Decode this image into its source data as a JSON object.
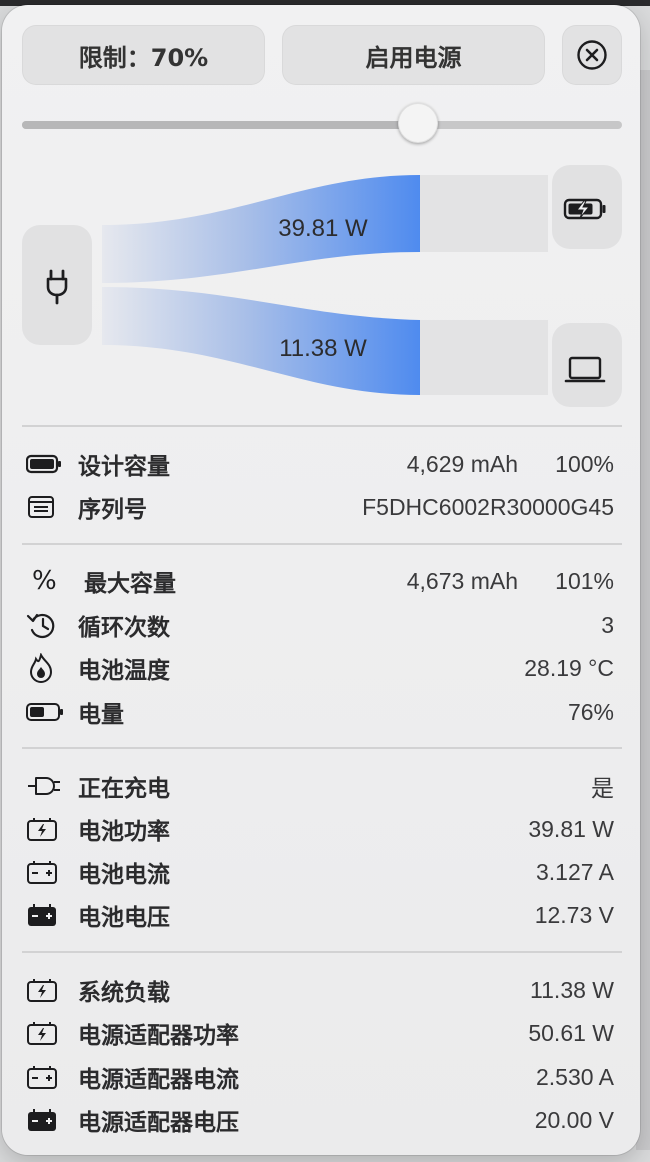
{
  "controls": {
    "limit_label": "限制：70%",
    "power_label": "启用电源",
    "charge_limit_percent": 70
  },
  "flow": {
    "battery_power": "39.81 W",
    "system_load": "11.38 W"
  },
  "section1": [
    {
      "icon": "battery-full-icon",
      "label": "设计容量",
      "value": "4,629 mAh",
      "value2": "100%"
    },
    {
      "icon": "serial-number-icon",
      "label": "序列号",
      "value": "F5DHC6002R30000G45"
    }
  ],
  "section2": [
    {
      "icon": "percent-icon",
      "label": "最大容量",
      "value": "4,673 mAh",
      "value2": "101%"
    },
    {
      "icon": "cycle-count-icon",
      "label": "循环次数",
      "value": "3"
    },
    {
      "icon": "temperature-icon",
      "label": "电池温度",
      "value": "28.19 °C"
    },
    {
      "icon": "battery-level-icon",
      "label": "电量",
      "value": "76%"
    }
  ],
  "section3": [
    {
      "icon": "charging-plug-icon",
      "label": "正在充电",
      "value": "是"
    },
    {
      "icon": "battery-power-icon",
      "label": "电池功率",
      "value": "39.81 W"
    },
    {
      "icon": "battery-current-icon",
      "label": "电池电流",
      "value": "3.127 A"
    },
    {
      "icon": "battery-voltage-icon",
      "label": "电池电压",
      "value": "12.73 V"
    }
  ],
  "section4": [
    {
      "icon": "system-load-icon",
      "label": "系统负载",
      "value": "11.38 W"
    },
    {
      "icon": "adapter-power-icon",
      "label": "电源适配器功率",
      "value": "50.61 W"
    },
    {
      "icon": "adapter-current-icon",
      "label": "电源适配器电流",
      "value": "2.530 A"
    },
    {
      "icon": "adapter-voltage-icon",
      "label": "电源适配器电压",
      "value": "20.00 V"
    }
  ],
  "colors": {
    "flow_blue": "#4f8bef",
    "panel_bg": "#efeff0"
  }
}
